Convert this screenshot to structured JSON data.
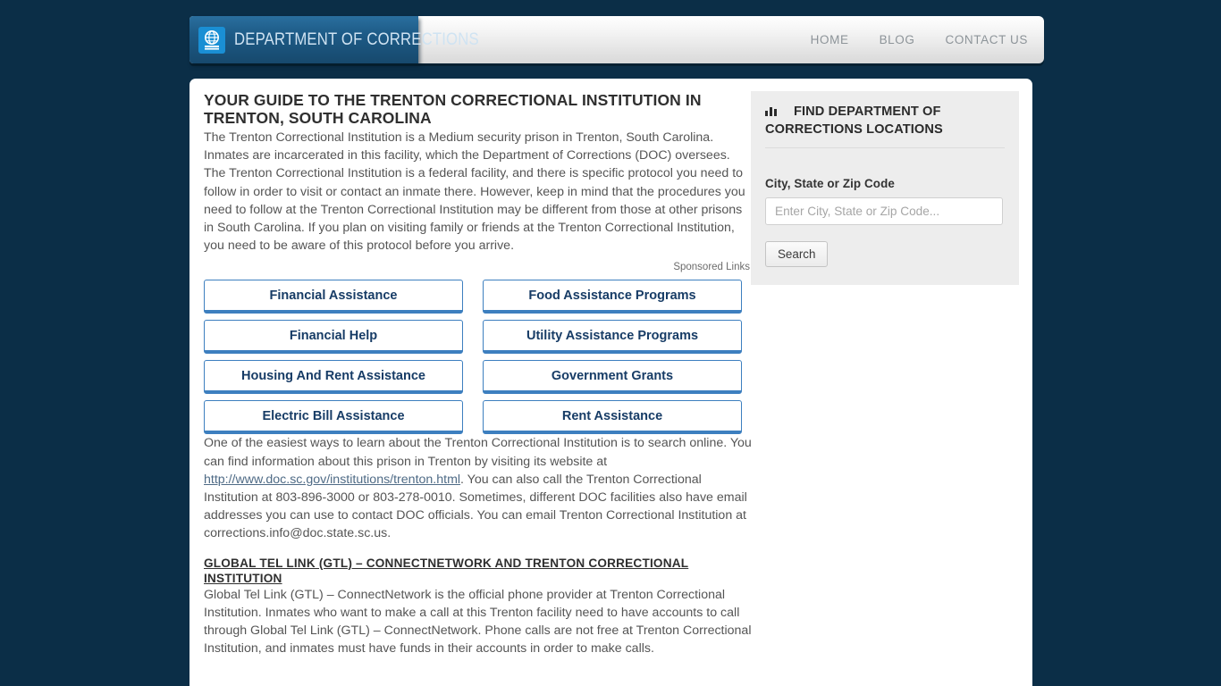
{
  "theme": {
    "page_background": "#0b2e47",
    "logo_blue": "#1d5b87",
    "accent_blue": "#3d7fbf",
    "link_blue": "#4f6b86",
    "sidebar_gray": "#ededed"
  },
  "header": {
    "logo_icon": "globe-badge-icon",
    "brand": "DEPARTMENT OF CORRECTIONS",
    "nav": [
      {
        "label": "HOME",
        "name": "nav-home"
      },
      {
        "label": "BLOG",
        "name": "nav-blog"
      },
      {
        "label": "CONTACT US",
        "name": "nav-contact-us"
      }
    ]
  },
  "main": {
    "title": "YOUR GUIDE TO THE TRENTON CORRECTIONAL INSTITUTION IN TRENTON, SOUTH CAROLINA",
    "intro_paragraph": "The Trenton Correctional Institution is a Medium security prison in Trenton, South Carolina. Inmates are incarcerated in this facility, which the Department of Corrections (DOC) oversees. The Trenton Correctional Institution is a federal facility, and there is specific protocol you need to follow in order to visit or contact an inmate there. However, keep in mind that the procedures you need to follow at the Trenton Correctional Institution may be different from those at other prisons in South Carolina. If you plan on visiting family or friends at the Trenton Correctional Institution, you need to be aware of this protocol before you arrive.",
    "sponsored_label": "Sponsored Links",
    "ads": [
      {
        "label": "Financial Assistance",
        "name": "ad-financial-assistance"
      },
      {
        "label": "Food Assistance Programs",
        "name": "ad-food-assistance-programs"
      },
      {
        "label": "Financial Help",
        "name": "ad-financial-help"
      },
      {
        "label": "Utility Assistance Programs",
        "name": "ad-utility-assistance-programs"
      },
      {
        "label": "Housing And Rent Assistance",
        "name": "ad-housing-and-rent-assistance"
      },
      {
        "label": "Government Grants",
        "name": "ad-government-grants"
      },
      {
        "label": "Electric Bill Assistance",
        "name": "ad-electric-bill-assistance"
      },
      {
        "label": "Rent Assistance",
        "name": "ad-rent-assistance"
      }
    ],
    "contact_paragraph_part1": "One of the easiest ways to learn about the Trenton Correctional Institution is to search online. You can find information about this prison in Trenton by visiting its website at ",
    "website_link": "http://www.doc.sc.gov/institutions/trenton.html",
    "contact_paragraph_part2": ". You can also call the Trenton Correctional Institution at 803-896-3000 or 803-278-0010. Sometimes, different DOC facilities also have email addresses you can use to contact DOC officials. You can email Trenton Correctional Institution at corrections.info@doc.state.sc.us.",
    "gtl_heading": "GLOBAL TEL LINK (GTL) – CONNECTNETWORK AND TRENTON CORRECTIONAL INSTITUTION",
    "gtl_paragraph": "Global Tel Link (GTL) – ConnectNetwork is the official phone provider at Trenton Correctional Institution. Inmates who want to make a call at this Trenton facility need to have accounts to call through Global Tel Link (GTL) – ConnectNetwork. Phone calls are not free at Trenton Correctional Institution, and inmates must have funds in their accounts in order to make calls."
  },
  "sidebar": {
    "widget_icon": "bar-chart-icon",
    "widget_title": "FIND DEPARTMENT OF CORRECTIONS LOCATIONS",
    "field_label": "City, State or Zip Code",
    "input_placeholder": "Enter City, State or Zip Code...",
    "input_value": "",
    "search_button": "Search"
  }
}
